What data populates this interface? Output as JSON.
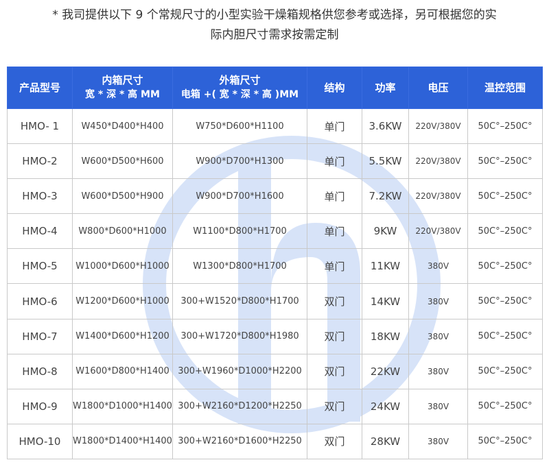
{
  "intro": {
    "line1": "* 我司提供以下 9 个常规尺寸的小型实验干燥箱规格供您参考或选择，另可根据您的实",
    "line2": "际内胆尺寸需求按需定制"
  },
  "colors": {
    "header_bg": "#2d62d8",
    "watermark": "#d7e3f8"
  },
  "table": {
    "headers": {
      "model": "产品型号",
      "inner_title": "内箱尺寸",
      "inner_sub": "宽 * 深 * 高 MM",
      "outer_title": "外箱尺寸",
      "outer_sub": "电箱 +( 宽 * 深 * 高 )MM",
      "structure": "结构",
      "power": "功率",
      "voltage": "电压",
      "temp": "温控范围"
    },
    "rows": [
      {
        "model": "HMO- 1",
        "inner": "W450*D400*H400",
        "outer": "W750*D600*H1100",
        "structure": "单门",
        "power": "3.6KW",
        "voltage": "220V/380V",
        "temp": "50C°–250C°"
      },
      {
        "model": "HMO-2",
        "inner": "W600*D500*H600",
        "outer": "W900*D700*H1300",
        "structure": "单门",
        "power": "5.5KW",
        "voltage": "220V/380V",
        "temp": "50C°–250C°"
      },
      {
        "model": "HMO-3",
        "inner": "W600*D500*H900",
        "outer": "W900*D700*H1600",
        "structure": "单门",
        "power": "7.2KW",
        "voltage": "220V/380V",
        "temp": "50C°–250C°"
      },
      {
        "model": "HMO-4",
        "inner": "W800*D600*H1000",
        "outer": "W1100*D800*H1700",
        "structure": "单门",
        "power": "9KW",
        "voltage": "220V/380V",
        "temp": "50C°–250C°"
      },
      {
        "model": "HMO-5",
        "inner": "W1000*D600*H1000",
        "outer": "W1300*D800*H1700",
        "structure": "单门",
        "power": "11KW",
        "voltage": "380V",
        "temp": "50C°–250C°"
      },
      {
        "model": "HMO-6",
        "inner": "W1200*D600*H1000",
        "outer": "300+W1520*D800*H1700",
        "structure": "双门",
        "power": "14KW",
        "voltage": "380V",
        "temp": "50C°–250C°"
      },
      {
        "model": "HMO-7",
        "inner": "W1400*D600*H1200",
        "outer": "300+W1720*D800*H1980",
        "structure": "双门",
        "power": "18KW",
        "voltage": "380V",
        "temp": "50C°–250C°"
      },
      {
        "model": "HMO-8",
        "inner": "W1600*D800*H1400",
        "outer": "300+W1960*D1000*H2200",
        "structure": "双门",
        "power": "22KW",
        "voltage": "380V",
        "temp": "50C°–250C°"
      },
      {
        "model": "HMO-9",
        "inner": "W1800*D1000*H1400",
        "outer": "300+W2160*D1200*H2250",
        "structure": "双门",
        "power": "24KW",
        "voltage": "380V",
        "temp": "50C°–250C°"
      },
      {
        "model": "HMO-10",
        "inner": "W1800*D1400*H1400",
        "outer": "300+W2160*D1600*H2250",
        "structure": "双门",
        "power": "28KW",
        "voltage": "380V",
        "temp": "50C°–250C°"
      }
    ]
  }
}
